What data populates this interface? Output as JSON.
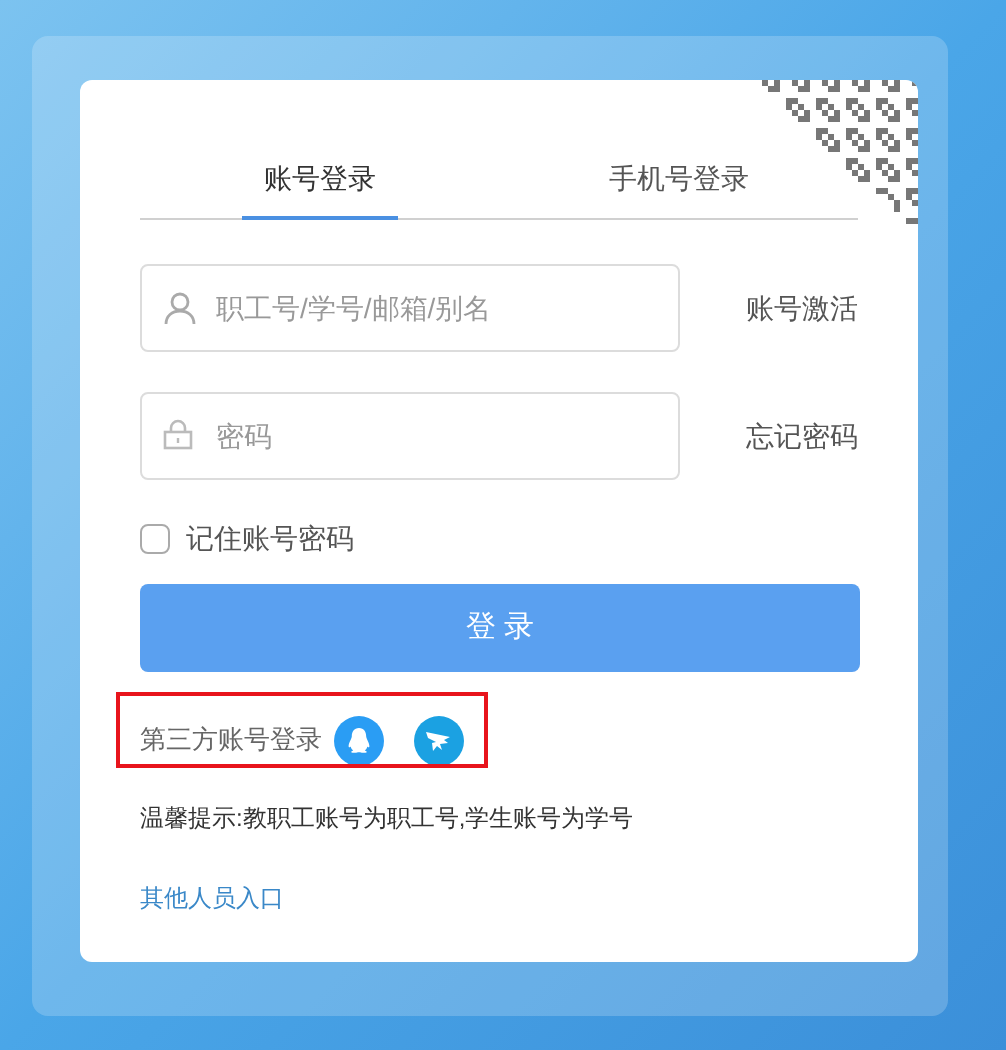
{
  "tabs": [
    {
      "label": "账号登录",
      "selected": true
    },
    {
      "label": "手机号登录",
      "selected": false
    }
  ],
  "fields": [
    {
      "kind": "user",
      "placeholder": "职工号/学号/邮箱/别名",
      "link": "账号激活"
    },
    {
      "kind": "password",
      "placeholder": "密码",
      "link": "忘记密码"
    }
  ],
  "remember": {
    "label": "记住账号密码",
    "checked": false
  },
  "login_button": "登 录",
  "third_party": {
    "label": "第三方账号登录"
  },
  "tip": "温馨提示:教职工账号为职工号,学生账号为学号",
  "other_link": "其他人员入口"
}
